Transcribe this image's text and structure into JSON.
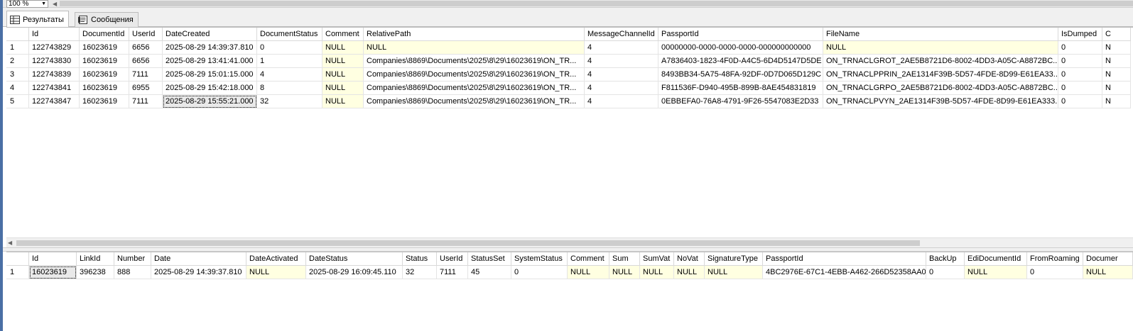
{
  "toolbar": {
    "zoom_value": "100 %"
  },
  "tabs": [
    {
      "label": "Результаты",
      "icon": "grid-icon",
      "active": true
    },
    {
      "label": "Сообщения",
      "icon": "messages-icon",
      "active": false
    }
  ],
  "grid1": {
    "columns": [
      "Id",
      "DocumentId",
      "UserId",
      "DateCreated",
      "DocumentStatus",
      "Comment",
      "RelativePath",
      "MessageChannelId",
      "PassportId",
      "FileName",
      "IsDumped",
      "C"
    ],
    "rows": [
      [
        "1",
        "122743829",
        "16023619",
        "6656",
        "2025-08-29 14:39:37.810",
        "0",
        "NULL",
        "NULL",
        "4",
        "00000000-0000-0000-0000-000000000000",
        "NULL",
        "0",
        "N"
      ],
      [
        "2",
        "122743830",
        "16023619",
        "6656",
        "2025-08-29 13:41:41.000",
        "1",
        "NULL",
        "Companies\\8869\\Documents\\2025\\8\\29\\16023619\\ON_TR...",
        "4",
        "A7836403-1823-4F0D-A4C5-6D4D5147D5DE",
        "ON_TRNACLGROT_2AE5B8721D6-8002-4DD3-A05C-A8872BC...",
        "0",
        "N"
      ],
      [
        "3",
        "122743839",
        "16023619",
        "7111",
        "2025-08-29 15:01:15.000",
        "4",
        "NULL",
        "Companies\\8869\\Documents\\2025\\8\\29\\16023619\\ON_TR...",
        "4",
        "8493BB34-5A75-48FA-92DF-0D7D065D129C",
        "ON_TRNACLPPRIN_2AE1314F39B-5D57-4FDE-8D99-E61EA33...",
        "0",
        "N"
      ],
      [
        "4",
        "122743841",
        "16023619",
        "6955",
        "2025-08-29 15:42:18.000",
        "8",
        "NULL",
        "Companies\\8869\\Documents\\2025\\8\\29\\16023619\\ON_TR...",
        "4",
        "F811536F-D940-495B-899B-8AE454831819",
        "ON_TRNACLGRPO_2AE5B8721D6-8002-4DD3-A05C-A8872BC...",
        "0",
        "N"
      ],
      [
        "5",
        "122743847",
        "16023619",
        "7111",
        "2025-08-29 15:55:21.000",
        "32",
        "NULL",
        "Companies\\8869\\Documents\\2025\\8\\29\\16023619\\ON_TR...",
        "4",
        "0EBBEFA0-76A8-4791-9F26-5547083E2D33",
        "ON_TRNACLPVYN_2AE1314F39B-5D57-4FDE-8D99-E61EA333...",
        "0",
        "N"
      ]
    ]
  },
  "grid2": {
    "columns": [
      "Id",
      "LinkId",
      "Number",
      "Date",
      "DateActivated",
      "DateStatus",
      "Status",
      "UserId",
      "StatusSet",
      "SystemStatus",
      "Comment",
      "Sum",
      "SumVat",
      "NoVat",
      "SignatureType",
      "PassportId",
      "BackUp",
      "EdiDocumentId",
      "FromRoaming",
      "Documer"
    ],
    "rows": [
      [
        "1",
        "16023619",
        "396238",
        "888",
        "2025-08-29 14:39:37.810",
        "NULL",
        "2025-08-29 16:09:45.110",
        "32",
        "7111",
        "45",
        "0",
        "NULL",
        "NULL",
        "NULL",
        "NULL",
        "NULL",
        "4BC2976E-67C1-4EBB-A462-266D52358AA0",
        "0",
        "NULL",
        "0",
        "NULL"
      ]
    ]
  }
}
